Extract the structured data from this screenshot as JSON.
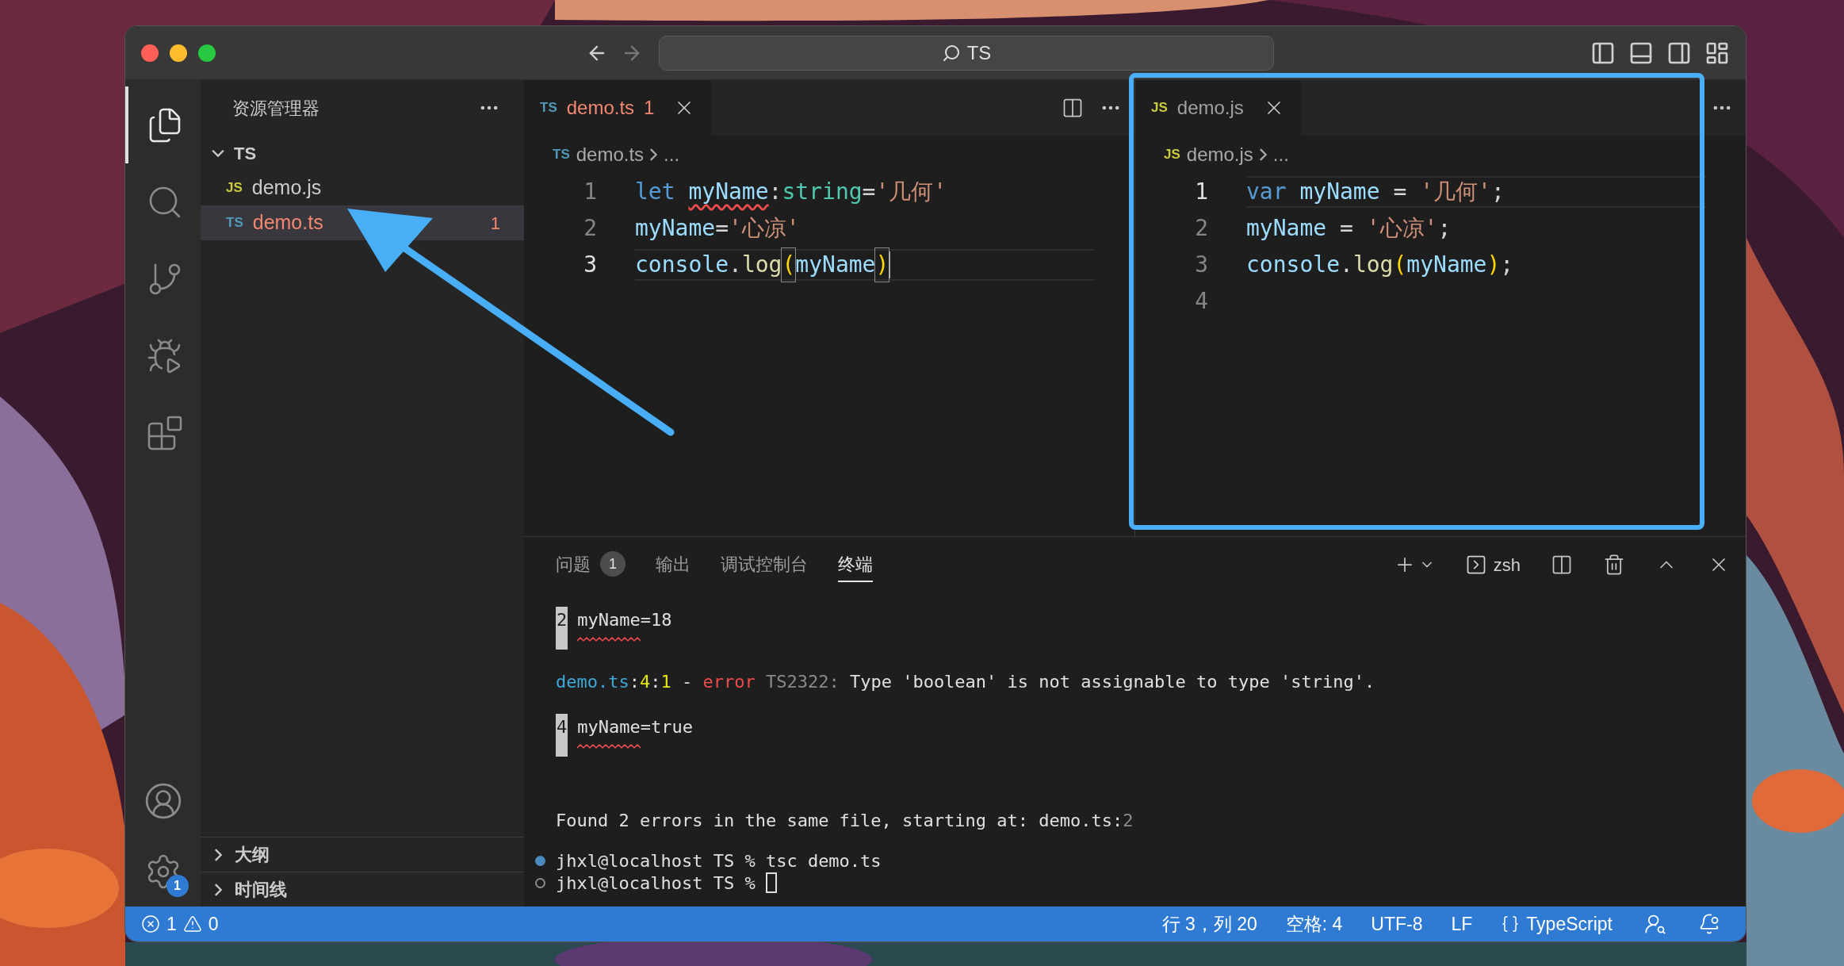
{
  "title_bar": {
    "search": "TS",
    "back_enabled": true,
    "forward_enabled": false
  },
  "activity_bar": [
    {
      "kind": "explorer",
      "selected": true
    },
    {
      "kind": "search",
      "selected": false
    },
    {
      "kind": "source_control",
      "selected": false
    },
    {
      "kind": "run_debug",
      "selected": false
    },
    {
      "kind": "extensions",
      "selected": false
    }
  ],
  "manage": {
    "badge": "1"
  },
  "sidebar": {
    "title": "资源管理器",
    "folder": {
      "name": "TS",
      "expanded": true,
      "children": [
        {
          "badge": "JS",
          "name": "demo.js",
          "selected": false,
          "error": false
        },
        {
          "badge": "TS",
          "name": "demo.ts",
          "selected": true,
          "error": true,
          "problems": "1"
        }
      ]
    },
    "sections": [
      {
        "title": "大纲",
        "expanded": false
      },
      {
        "title": "时间线",
        "expanded": false
      }
    ]
  },
  "editor_groups": [
    {
      "tabs": [
        {
          "badge": "TS",
          "name": "demo.ts",
          "problems": "1",
          "error": true,
          "selected": true
        }
      ],
      "breadcrumb": {
        "badge": "TS",
        "file": "demo.ts",
        "rest": "..."
      },
      "lines": [
        {
          "number": "1",
          "current": false,
          "cursor": false,
          "tokens": [
            {
              "text": "let ",
              "kind": "keyword"
            },
            {
              "text": "myName",
              "kind": "variable",
              "squiggle": true
            },
            {
              "text": ":",
              "kind": "punct"
            },
            {
              "text": "string",
              "kind": "type"
            },
            {
              "text": "=",
              "kind": "punct"
            },
            {
              "text": "'几何'",
              "kind": "string"
            }
          ]
        },
        {
          "number": "2",
          "current": false,
          "cursor": false,
          "tokens": [
            {
              "text": "myName",
              "kind": "variable"
            },
            {
              "text": "=",
              "kind": "punct"
            },
            {
              "text": "'心凉'",
              "kind": "string"
            }
          ]
        },
        {
          "number": "3",
          "current": true,
          "cursor": true,
          "tokens": [
            {
              "text": "console",
              "kind": "variable"
            },
            {
              "text": ".",
              "kind": "punct"
            },
            {
              "text": "log",
              "kind": "function"
            },
            {
              "text": "(",
              "kind": "bracket",
              "matched": true
            },
            {
              "text": "myName",
              "kind": "variable"
            },
            {
              "text": ")",
              "kind": "bracket",
              "matched": true
            }
          ]
        }
      ]
    },
    {
      "tabs": [
        {
          "badge": "JS",
          "name": "demo.js",
          "error": false,
          "selected": true
        }
      ],
      "breadcrumb": {
        "badge": "JS",
        "file": "demo.js",
        "rest": "..."
      },
      "lines": [
        {
          "number": "1",
          "current": true,
          "cursor": false,
          "tokens": [
            {
              "text": "var ",
              "kind": "keyword"
            },
            {
              "text": "myName",
              "kind": "variable"
            },
            {
              "text": " = ",
              "kind": "punct"
            },
            {
              "text": "'几何'",
              "kind": "string"
            },
            {
              "text": ";",
              "kind": "punct"
            }
          ]
        },
        {
          "number": "2",
          "current": false,
          "cursor": false,
          "tokens": [
            {
              "text": "myName",
              "kind": "variable"
            },
            {
              "text": " = ",
              "kind": "punct"
            },
            {
              "text": "'心凉'",
              "kind": "string"
            },
            {
              "text": ";",
              "kind": "punct"
            }
          ]
        },
        {
          "number": "3",
          "current": false,
          "cursor": false,
          "tokens": [
            {
              "text": "console",
              "kind": "variable"
            },
            {
              "text": ".",
              "kind": "punct"
            },
            {
              "text": "log",
              "kind": "function"
            },
            {
              "text": "(",
              "kind": "bracket"
            },
            {
              "text": "myName",
              "kind": "variable"
            },
            {
              "text": ")",
              "kind": "bracket"
            },
            {
              "text": ";",
              "kind": "punct"
            }
          ]
        },
        {
          "number": "4",
          "current": false
        }
      ]
    }
  ],
  "panel": {
    "tabs": [
      {
        "label": "问题",
        "badge": "1",
        "selected": false
      },
      {
        "label": "输出",
        "selected": false
      },
      {
        "label": "调试控制台",
        "selected": false
      },
      {
        "label": "终端",
        "selected": true
      }
    ],
    "shell": "zsh",
    "terminal": [
      {
        "kind": "source",
        "gutter": "2",
        "text": "myName=18"
      },
      {
        "kind": "message",
        "segments": [
          {
            "text": "demo.ts",
            "kind": "path"
          },
          {
            "text": ":",
            "kind": "plain"
          },
          {
            "text": "4",
            "kind": "number"
          },
          {
            "text": ":",
            "kind": "plain"
          },
          {
            "text": "1",
            "kind": "number"
          },
          {
            "text": " - ",
            "kind": "plain"
          },
          {
            "text": "error",
            "kind": "error"
          },
          {
            "text": " TS2322:",
            "kind": "dim"
          },
          {
            "text": " Type 'boolean' is not assignable to type 'string'.",
            "kind": "plain"
          }
        ]
      },
      {
        "kind": "source",
        "gutter": "4",
        "text": "myName=true"
      },
      {
        "kind": "summary",
        "segments": [
          {
            "text": "Found 2 errors in the same file, starting at: demo.ts:",
            "kind": "plain"
          },
          {
            "text": "2",
            "kind": "dim"
          }
        ]
      },
      {
        "kind": "prompt",
        "done": true,
        "cursor": false,
        "text": "jhxl@localhost TS % tsc demo.ts"
      },
      {
        "kind": "prompt",
        "done": false,
        "cursor": true,
        "text": "jhxl@localhost TS % "
      }
    ]
  },
  "status_bar": {
    "errors": "1",
    "warnings": "0",
    "items": [
      "行 3，列 20",
      "空格: 4",
      "UTF-8",
      "LF"
    ],
    "language": "TypeScript"
  }
}
